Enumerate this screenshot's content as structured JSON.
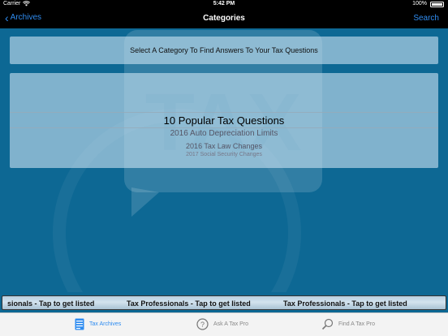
{
  "status_bar": {
    "carrier": "Carrier",
    "time": "5:42 PM",
    "battery": "100%"
  },
  "nav": {
    "back_label": "Archives",
    "title": "Categories",
    "search_label": "Search"
  },
  "instruction": "Select A Category To Find Answers To Your Tax Questions",
  "picker": {
    "items": [
      "10 Popular Tax Questions",
      "2016 Auto Depreciation Limits",
      "2016 Tax Law Changes",
      "2017 Social Security Changes"
    ],
    "selected_index": 0
  },
  "watermark_text": "TAX",
  "ticker": {
    "segments": [
      "sionals - Tap to get listed",
      "Tax Professionals - Tap to get listed",
      "Tax Professionals - Tap to get listed"
    ]
  },
  "tabs": [
    {
      "label": "Tax Archives",
      "icon": "archive-icon",
      "active": true
    },
    {
      "label": "Ask A Tax Pro",
      "icon": "question-circle-icon",
      "active": false
    },
    {
      "label": "Find A Tax Pro",
      "icon": "magnifier-icon",
      "active": false
    }
  ],
  "colors": {
    "background": "#0d6894",
    "accent": "#2f8cf0",
    "nav_bar": "#000000"
  }
}
